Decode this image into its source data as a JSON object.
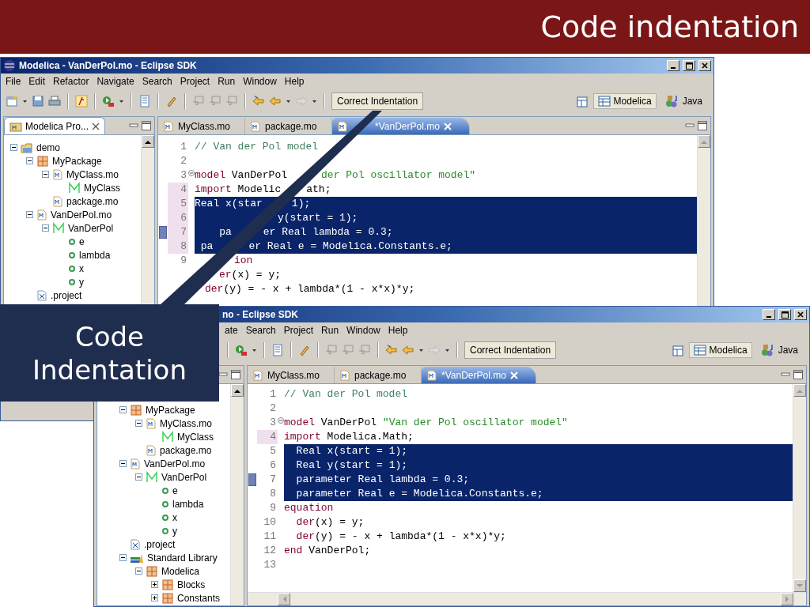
{
  "slide": {
    "title": "Code indentation"
  },
  "callout": {
    "text": "Code Indentation"
  },
  "windows": [
    {
      "title": "Modelica - VanDerPol.mo - Eclipse SDK",
      "menu": [
        "File",
        "Edit",
        "Refactor",
        "Navigate",
        "Search",
        "Project",
        "Run",
        "Window",
        "Help"
      ],
      "toolbar_button": "Correct Indentation",
      "perspectives": [
        {
          "label": "Modelica",
          "selected": true
        },
        {
          "label": "Java",
          "selected": false
        }
      ],
      "view_tab": "Modelica Pro...",
      "tree": [
        {
          "label": "demo",
          "kind": "project",
          "expanded": true,
          "children": [
            {
              "label": "MyPackage",
              "kind": "package",
              "expanded": true,
              "children": [
                {
                  "label": "MyClass.mo",
                  "kind": "file",
                  "expanded": true,
                  "children": [
                    {
                      "label": "MyClass",
                      "kind": "class"
                    }
                  ]
                },
                {
                  "label": "package.mo",
                  "kind": "file"
                }
              ]
            },
            {
              "label": "VanDerPol.mo",
              "kind": "file",
              "expanded": true,
              "children": [
                {
                  "label": "VanDerPol",
                  "kind": "class",
                  "expanded": true,
                  "children": [
                    {
                      "label": "e",
                      "kind": "field"
                    },
                    {
                      "label": "lambda",
                      "kind": "field"
                    },
                    {
                      "label": "x",
                      "kind": "field"
                    },
                    {
                      "label": "y",
                      "kind": "field"
                    }
                  ]
                }
              ]
            },
            {
              "label": ".project",
              "kind": "xml"
            }
          ]
        }
      ],
      "editor_tabs": [
        {
          "label": "MyClass.mo",
          "selected": false
        },
        {
          "label": "package.mo",
          "selected": false
        },
        {
          "label": "*VanDerPol.mo",
          "selected": true
        }
      ],
      "code": [
        {
          "number": "1",
          "changed": false,
          "selected": false,
          "marker": false,
          "fold": false,
          "tokens": [
            {
              "kind": "comment",
              "text": "// Van der Pol model"
            }
          ]
        },
        {
          "number": "2",
          "changed": false,
          "selected": false,
          "marker": false,
          "fold": false
        },
        {
          "number": "3",
          "changed": false,
          "selected": false,
          "marker": false,
          "fold": true,
          "tokens": [
            {
              "kind": "keyword",
              "text": "model"
            },
            {
              "kind": "plain",
              "text": " VanDerPol"
            }
          ],
          "tokens_after": [
            {
              "kind": "string",
              "text": "der Pol oscillator model\""
            }
          ]
        },
        {
          "number": "4",
          "changed": true,
          "selected": false,
          "marker": false,
          "fold": false,
          "tokens": [
            {
              "kind": "keyword",
              "text": "import"
            },
            {
              "kind": "plain",
              "text": " Modelic"
            }
          ],
          "tokens_after": [
            {
              "kind": "plain",
              "text": "ath;"
            }
          ]
        },
        {
          "number": "5",
          "changed": true,
          "selected": true,
          "marker": false,
          "fold": false,
          "tokens": [
            {
              "kind": "keyword",
              "text": "Real"
            },
            {
              "kind": "plain",
              "text": " x(star"
            }
          ],
          "tokens_after": [
            {
              "kind": "plain",
              "text": "1);"
            }
          ]
        },
        {
          "number": "6",
          "changed": true,
          "selected": true,
          "marker": false,
          "fold": false,
          "tokens_after": [
            {
              "kind": "plain",
              "text": "y(start = 1);"
            }
          ]
        },
        {
          "number": "7",
          "changed": true,
          "selected": true,
          "marker": true,
          "fold": false,
          "tokens": [
            {
              "kind": "keyword",
              "text": "    pa"
            }
          ],
          "tokens_after": [
            {
              "kind": "keyword",
              "text": "er Real"
            },
            {
              "kind": "plain",
              "text": " lambda = 0.3;"
            }
          ]
        },
        {
          "number": "8",
          "changed": true,
          "selected": true,
          "marker": false,
          "fold": false,
          "tokens": [
            {
              "kind": "keyword",
              "text": " pa"
            }
          ],
          "tokens_after": [
            {
              "kind": "keyword",
              "text": "er Real"
            },
            {
              "kind": "plain",
              "text": " e = Modelica.Constants.e;"
            }
          ]
        },
        {
          "number": "9",
          "changed": false,
          "selected": false,
          "marker": false,
          "fold": false,
          "tokens_after": [
            {
              "kind": "keyword",
              "text": "ion"
            }
          ]
        },
        {
          "selected": false,
          "marker": false,
          "fold": false,
          "tokens_after": [
            {
              "kind": "keyword",
              "text": "er"
            },
            {
              "kind": "plain",
              "text": "(x) = y;"
            }
          ]
        },
        {
          "selected": false,
          "marker": false,
          "fold": false,
          "tokens_after": [
            {
              "kind": "keyword",
              "text": "der"
            },
            {
              "kind": "plain",
              "text": "(y) = - x + lambda*(1 - x*x)*y;"
            }
          ]
        }
      ]
    },
    {
      "title": "no - Eclipse SDK",
      "menu": [
        "ate",
        "Search",
        "Project",
        "Run",
        "Window",
        "Help"
      ],
      "toolbar_button": "Correct Indentation",
      "perspectives": [
        {
          "label": "Modelica",
          "selected": true
        },
        {
          "label": "Java",
          "selected": false
        }
      ],
      "tree": [
        {
          "label": "MyPackage",
          "kind": "package",
          "expanded": true,
          "children": [
            {
              "label": "MyClass.mo",
              "kind": "file",
              "expanded": true,
              "children": [
                {
                  "label": "MyClass",
                  "kind": "class"
                }
              ]
            },
            {
              "label": "package.mo",
              "kind": "file"
            }
          ]
        },
        {
          "label": "VanDerPol.mo",
          "kind": "file",
          "expanded": true,
          "children": [
            {
              "label": "VanDerPol",
              "kind": "class",
              "expanded": true,
              "children": [
                {
                  "label": "e",
                  "kind": "field"
                },
                {
                  "label": "lambda",
                  "kind": "field"
                },
                {
                  "label": "x",
                  "kind": "field"
                },
                {
                  "label": "y",
                  "kind": "field"
                }
              ]
            }
          ]
        },
        {
          "label": ".project",
          "kind": "xml"
        },
        {
          "label": "Standard Library",
          "kind": "library",
          "expanded": true,
          "children": [
            {
              "label": "Modelica",
              "kind": "package",
              "expanded": true,
              "children": [
                {
                  "label": "Blocks",
                  "kind": "package",
                  "expanded": false
                },
                {
                  "label": "Constants",
                  "kind": "package",
                  "expanded": false
                }
              ]
            }
          ]
        }
      ],
      "editor_tabs": [
        {
          "label": "MyClass.mo",
          "selected": false
        },
        {
          "label": "package.mo",
          "selected": false
        },
        {
          "label": "*VanDerPol.mo",
          "selected": true
        }
      ],
      "code": [
        {
          "number": "1",
          "changed": false,
          "selected": false,
          "marker": false,
          "fold": false,
          "tokens": [
            {
              "kind": "comment",
              "text": "// Van der Pol model"
            }
          ]
        },
        {
          "number": "2",
          "changed": false,
          "selected": false,
          "marker": false,
          "fold": false
        },
        {
          "number": "3",
          "changed": false,
          "selected": false,
          "marker": false,
          "fold": true,
          "tokens": [
            {
              "kind": "keyword",
              "text": "model"
            },
            {
              "kind": "plain",
              "text": " VanDerPol "
            },
            {
              "kind": "string",
              "text": "\"Van der Pol oscillator model\""
            }
          ]
        },
        {
          "number": "4",
          "changed": true,
          "selected": false,
          "marker": false,
          "fold": false,
          "tokens": [
            {
              "kind": "keyword",
              "text": "import"
            },
            {
              "kind": "plain",
              "text": " Modelica.Math;"
            }
          ]
        },
        {
          "number": "5",
          "changed": false,
          "selected": true,
          "marker": false,
          "fold": false,
          "tokens": [
            {
              "kind": "keyword",
              "text": "  Real"
            },
            {
              "kind": "plain",
              "text": " x(start = 1);"
            }
          ]
        },
        {
          "number": "6",
          "changed": false,
          "selected": true,
          "marker": false,
          "fold": false,
          "tokens": [
            {
              "kind": "keyword",
              "text": "  Real"
            },
            {
              "kind": "plain",
              "text": " y(start = 1);"
            }
          ]
        },
        {
          "number": "7",
          "changed": false,
          "selected": true,
          "marker": true,
          "fold": false,
          "tokens": [
            {
              "kind": "keyword",
              "text": "  parameter Real"
            },
            {
              "kind": "plain",
              "text": " lambda = 0.3;"
            }
          ]
        },
        {
          "number": "8",
          "changed": false,
          "selected": true,
          "marker": false,
          "fold": false,
          "tokens": [
            {
              "kind": "keyword",
              "text": "  parameter Real"
            },
            {
              "kind": "plain",
              "text": " e = Modelica.Constants.e;"
            }
          ]
        },
        {
          "number": "9",
          "changed": false,
          "selected": false,
          "marker": false,
          "fold": false,
          "tokens": [
            {
              "kind": "keyword",
              "text": "equation"
            }
          ]
        },
        {
          "number": "10",
          "changed": false,
          "selected": false,
          "marker": false,
          "fold": false,
          "tokens": [
            {
              "kind": "keyword",
              "text": "  der"
            },
            {
              "kind": "plain",
              "text": "(x) = y;"
            }
          ]
        },
        {
          "number": "11",
          "changed": false,
          "selected": false,
          "marker": false,
          "fold": false,
          "tokens": [
            {
              "kind": "keyword",
              "text": "  der"
            },
            {
              "kind": "plain",
              "text": "(y) = - x + lambda*(1 - x*x)*y;"
            }
          ]
        },
        {
          "number": "12",
          "changed": false,
          "selected": false,
          "marker": false,
          "fold": false,
          "tokens": [
            {
              "kind": "keyword",
              "text": "end"
            },
            {
              "kind": "plain",
              "text": " VanDerPol;"
            }
          ]
        },
        {
          "number": "13",
          "changed": false,
          "selected": false,
          "marker": false,
          "fold": false
        }
      ]
    }
  ]
}
